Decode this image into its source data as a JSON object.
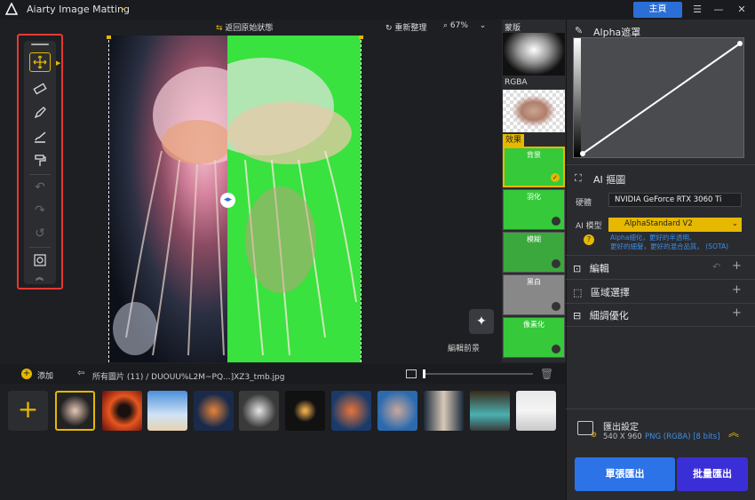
{
  "app": {
    "title": "Aiarty Image Matting",
    "home": "主頁"
  },
  "top": {
    "back_label": "返回原始狀態",
    "reset_label": "重新整理",
    "zoom": "67%"
  },
  "strip": {
    "mask_label": "蒙版",
    "rgba_label": "RGBA",
    "effects_label": "效果",
    "effects": [
      {
        "label": "背景",
        "checked": true
      },
      {
        "label": "羽化",
        "checked": false
      },
      {
        "label": "模糊",
        "checked": false
      },
      {
        "label": "黑白",
        "checked": false
      },
      {
        "label": "像素化",
        "checked": false
      }
    ]
  },
  "canvas": {
    "edit_fg_label": "編輯前景"
  },
  "panel": {
    "alpha_title": "Alpha遮罩",
    "ai_title": "AI 摳圖",
    "hw_label": "硬體",
    "hw_value": "NVIDIA GeForce RTX 3060 Ti",
    "model_label": "AI 模型",
    "model_value": "AlphaStandard  V2",
    "model_desc1": "Alpha細化，更好的半透明、",
    "model_desc2": "更好的細髮，更好的混合品質。 (SOTA)",
    "sections": [
      "編輯",
      "區域選擇",
      "細調優化"
    ],
    "export_title": "匯出設定",
    "export_size": "540 X 960",
    "export_format": "PNG (RGBA) [8 bits]",
    "single_export": "單張匯出",
    "batch_export": "批量匯出"
  },
  "files": {
    "add_label": "添加",
    "breadcrumb_all": "所有圖片 (11)",
    "breadcrumb_sep": "/",
    "breadcrumb_file": "DUOUU%L2M~PQ...]XZ3_tmb.jpg"
  },
  "colors": {
    "accent": "#e6b800",
    "blue": "#2b6fd6",
    "green": "#39e23e",
    "red_box": "#e53935"
  }
}
